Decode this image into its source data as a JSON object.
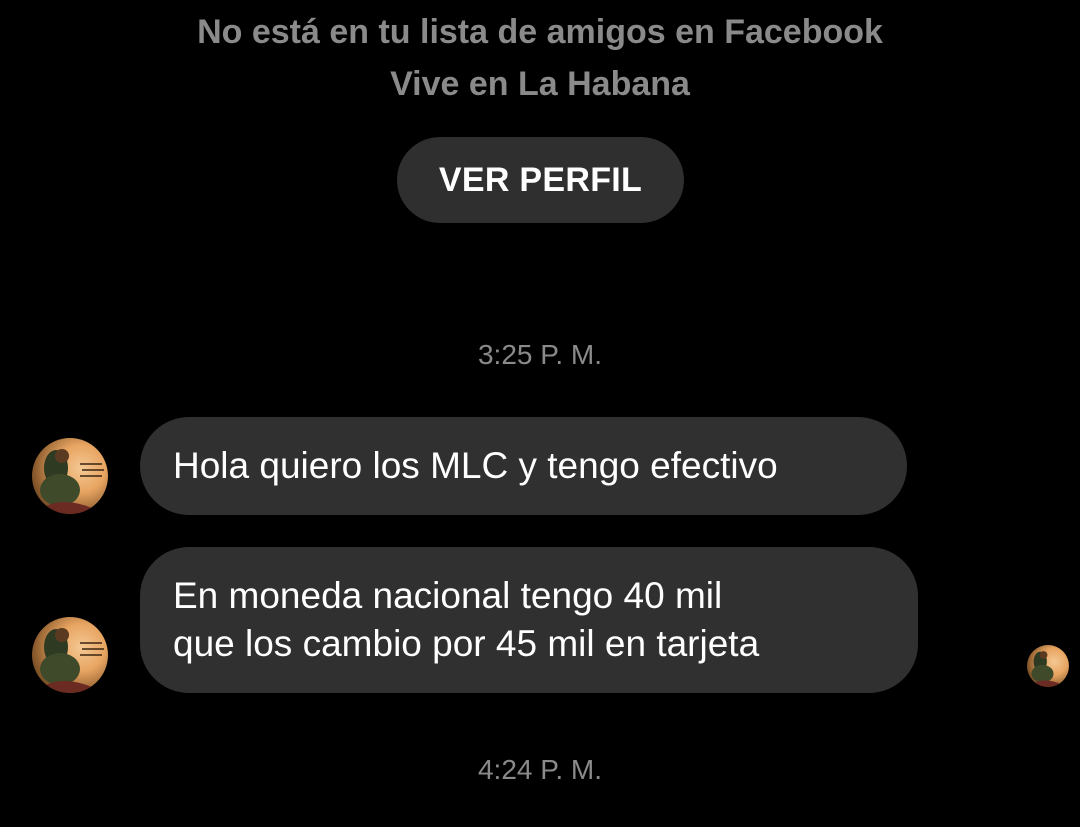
{
  "profile": {
    "not_friend_text": "No está en tu lista de amigos en Facebook",
    "location_text": "Vive en La Habana",
    "view_profile_label": "VER PERFIL"
  },
  "messages": [
    {
      "timestamp": "3:25 P. M.",
      "items": [
        {
          "lines": [
            "Hola quiero los MLC y tengo efectivo"
          ]
        },
        {
          "lines": [
            "En moneda nacional tengo 40 mil",
            "que los cambio por 45 mil en tarjeta"
          ]
        }
      ]
    },
    {
      "timestamp": "4:24 P. M."
    }
  ],
  "colors": {
    "background": "#000000",
    "bubble": "#303030",
    "secondary_text": "#8a8a8a",
    "button": "#2f2f2f"
  }
}
